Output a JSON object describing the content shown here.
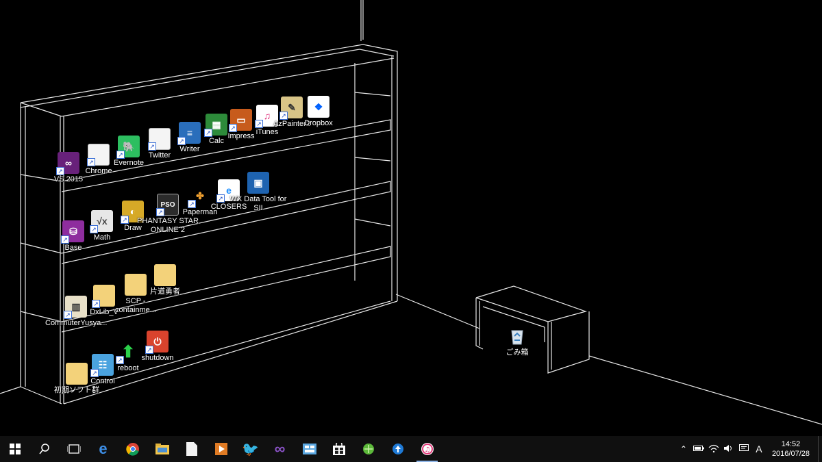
{
  "desktop": {
    "shelf_row_1": [
      {
        "label": "VS 2015",
        "icon": "visual-studio-icon"
      },
      {
        "label": "Chrome",
        "icon": "document-icon"
      },
      {
        "label": "Evernote",
        "icon": "evernote-icon"
      },
      {
        "label": "Twitter",
        "icon": "document-icon"
      },
      {
        "label": "Writer",
        "icon": "libreoffice-writer-icon"
      },
      {
        "label": "Calc",
        "icon": "libreoffice-calc-icon"
      },
      {
        "label": "Impress",
        "icon": "libreoffice-impress-icon"
      },
      {
        "label": "iTunes",
        "icon": "itunes-icon"
      },
      {
        "label": "AzPainter2",
        "icon": "azpainter-icon"
      },
      {
        "label": "Dropbox",
        "icon": "dropbox-icon"
      }
    ],
    "shelf_row_2": [
      {
        "label": "Base",
        "icon": "libreoffice-base-icon"
      },
      {
        "label": "Math",
        "icon": "libreoffice-math-icon"
      },
      {
        "label": "Draw",
        "icon": "libreoffice-draw-icon"
      },
      {
        "label": "PHANTASY STAR ONLINE 2",
        "icon": "pso2-icon"
      },
      {
        "label": "Paperman",
        "icon": "paperman-icon"
      },
      {
        "label": "CLOSERS",
        "icon": "internet-explorer-icon"
      },
      {
        "label": "WX Data Tool for SII",
        "icon": "wx-data-tool-icon"
      }
    ],
    "shelf_row_3": [
      {
        "label": "CommuterYusya...",
        "icon": "commuter-icon"
      },
      {
        "label": "DxLib_V",
        "icon": "folder-icon"
      },
      {
        "label": "SCP - containme...",
        "icon": "folder-icon"
      },
      {
        "label": "片道勇者",
        "icon": "folder-icon"
      }
    ],
    "shelf_row_4": [
      {
        "label": "初期ソフト群",
        "icon": "folder-icon"
      },
      {
        "label": "Control",
        "icon": "control-panel-icon"
      },
      {
        "label": "reboot",
        "icon": "reboot-arrow-icon"
      },
      {
        "label": "shutdown",
        "icon": "power-icon"
      }
    ],
    "recycle_bin": {
      "label": "ごみ箱",
      "icon": "recycle-bin-icon"
    }
  },
  "taskbar": {
    "pinned": [
      {
        "name": "start",
        "icon": "windows-start-icon"
      },
      {
        "name": "search",
        "icon": "search-icon"
      },
      {
        "name": "task-view",
        "icon": "task-view-icon"
      },
      {
        "name": "edge",
        "icon": "edge-icon"
      },
      {
        "name": "chrome",
        "icon": "chrome-icon"
      },
      {
        "name": "file-explorer",
        "icon": "folder-icon"
      },
      {
        "name": "document",
        "icon": "document-icon"
      },
      {
        "name": "media-player",
        "icon": "media-player-icon"
      },
      {
        "name": "twitter",
        "icon": "twitter-icon"
      },
      {
        "name": "visual-studio",
        "icon": "visual-studio-icon"
      },
      {
        "name": "control-panel",
        "icon": "control-panel-icon"
      },
      {
        "name": "store",
        "icon": "store-icon"
      },
      {
        "name": "game",
        "icon": "green-orb-icon"
      },
      {
        "name": "upload",
        "icon": "upload-icon"
      },
      {
        "name": "itunes",
        "icon": "itunes-icon",
        "active": true
      }
    ],
    "tray": {
      "icons": [
        "chevron-up-icon",
        "battery-icon",
        "wifi-icon",
        "volume-icon",
        "notification-icon"
      ],
      "ime": "A",
      "time": "14:52",
      "date": "2016/07/28"
    }
  }
}
